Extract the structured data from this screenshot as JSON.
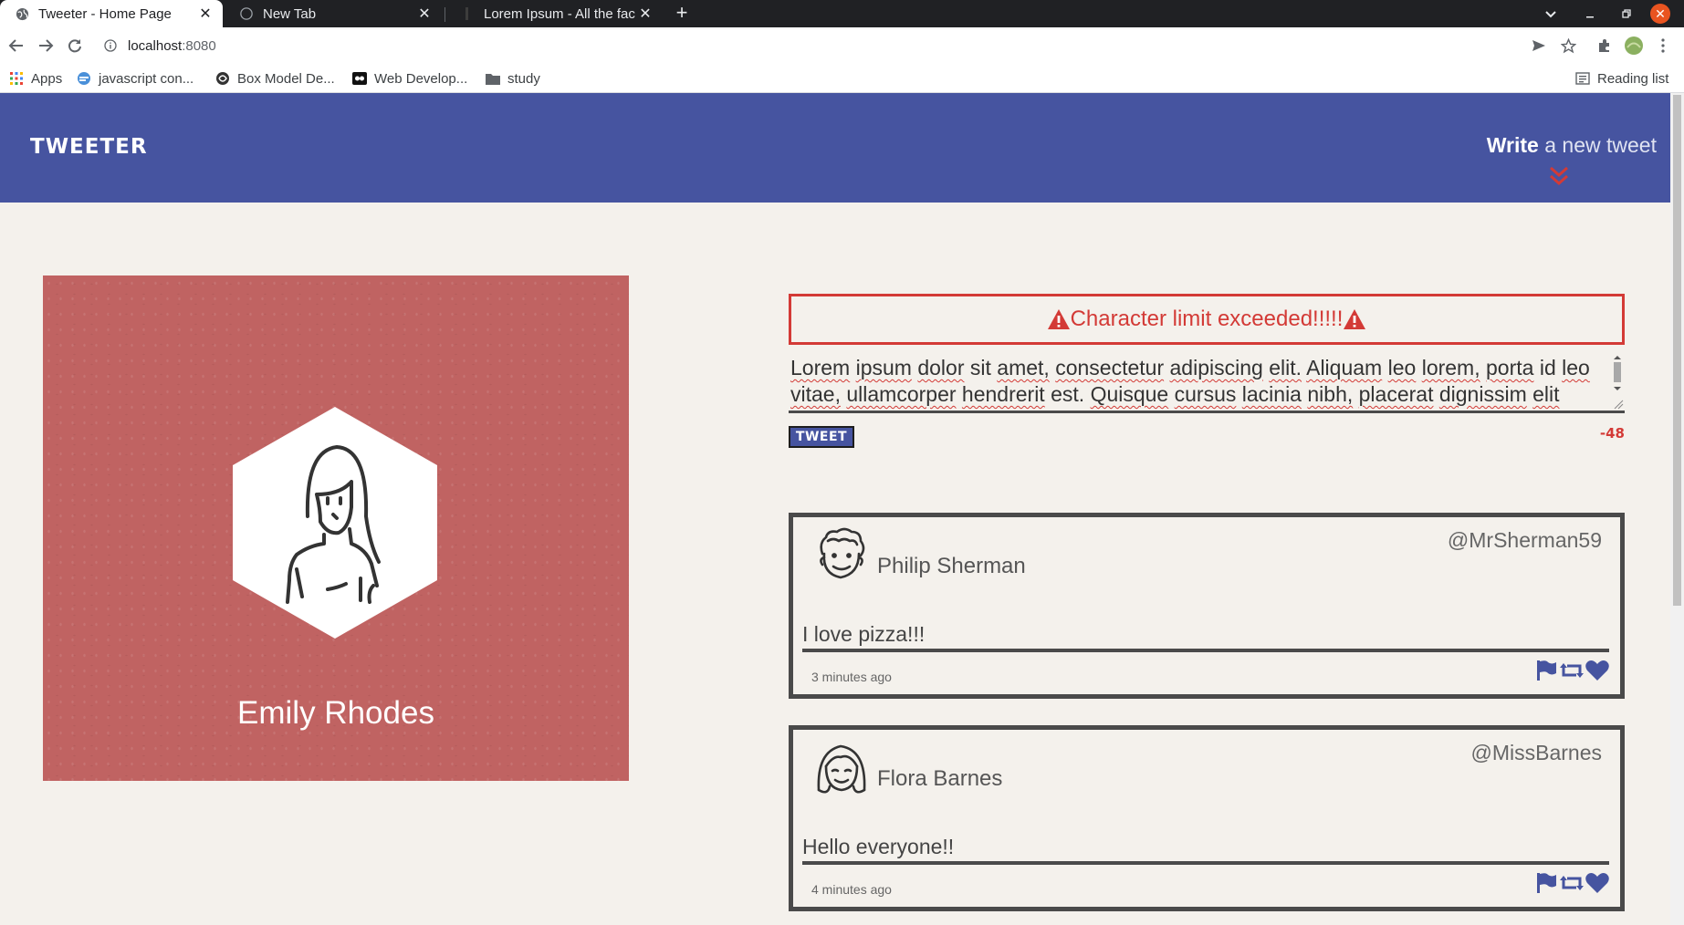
{
  "browser": {
    "tabs": [
      {
        "title": "Tweeter - Home Page",
        "active": true
      },
      {
        "title": "New Tab",
        "active": false
      },
      {
        "title": "Lorem Ipsum - All the facts - Lipsum generator",
        "active": false
      }
    ],
    "url_host": "localhost",
    "url_port": ":8080",
    "bookmarks": [
      {
        "label": "Apps",
        "icon": "apps-grid-icon"
      },
      {
        "label": "javascript con...",
        "icon": "site-favicon-icon"
      },
      {
        "label": "Box Model De...",
        "icon": "site-favicon-icon"
      },
      {
        "label": "Web Develop...",
        "icon": "site-favicon-icon"
      },
      {
        "label": "study",
        "icon": "folder-icon"
      }
    ],
    "reading_list": "Reading list"
  },
  "nav": {
    "brand": "TWEETER",
    "compose_bold": "Write",
    "compose_rest": " a new tweet"
  },
  "profile": {
    "name": "Emily Rhodes",
    "background_color": "#c06362"
  },
  "composer": {
    "error": "Character limit exceeded!!!!!",
    "text_words": [
      "Lorem",
      "ipsum",
      "dolor",
      "sit",
      "amet,",
      "consectetur",
      "adipiscing",
      "elit.",
      "Aliquam",
      "leo",
      "lorem,",
      "porta",
      "id",
      "leo",
      "vitae,",
      "ullamcorper",
      "hendrerit",
      "est.",
      "Quisque",
      "cursus",
      "lacinia",
      "nibh,",
      "placerat",
      "dignissim",
      "elit"
    ],
    "button": "TWEET",
    "counter": "-48"
  },
  "tweets": [
    {
      "name": "Philip Sherman",
      "handle": "@MrSherman59",
      "content": "I love pizza!!!",
      "time": "3 minutes ago"
    },
    {
      "name": "Flora Barnes",
      "handle": "@MissBarnes",
      "content": "Hello everyone!!",
      "time": "4 minutes ago"
    }
  ],
  "colors": {
    "nav": "#4654a0",
    "error": "#d33a36",
    "page_bg": "#f4f1ec"
  }
}
